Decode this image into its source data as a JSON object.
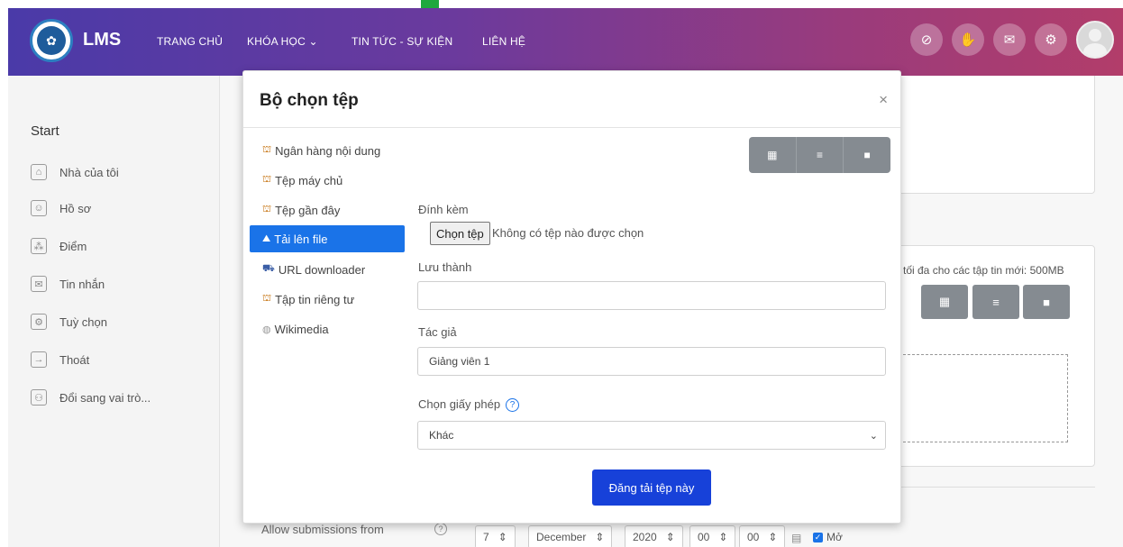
{
  "navbar": {
    "brand": "LMS",
    "links": [
      "TRANG CHỦ",
      "KHÓA HỌC ⌄",
      "TIN TỨC - SỰ KIỆN",
      "LIÊN HỆ"
    ],
    "icons": [
      "eye-slash-icon",
      "hand-icon",
      "chat-icon",
      "gear-icon"
    ]
  },
  "drawer": {
    "start": "Start",
    "items": [
      {
        "label": "Nhà của tôi",
        "icon": "home-icon"
      },
      {
        "label": "Hồ sơ",
        "icon": "profile-icon"
      },
      {
        "label": "Điểm",
        "icon": "grades-icon"
      },
      {
        "label": "Tin nhắn",
        "icon": "messages-icon"
      },
      {
        "label": "Tuỳ chọn",
        "icon": "preferences-icon"
      },
      {
        "label": "Thoát",
        "icon": "logout-icon"
      },
      {
        "label": "Đổi sang vai trò...",
        "icon": "switch-role-icon"
      }
    ]
  },
  "background": {
    "max_size": "tối đa cho các tập tin mới: 500MB",
    "allow_submissions": "Allow submissions from",
    "day": "7",
    "month": "December",
    "year": "2020",
    "hour": "00",
    "minute": "00",
    "enable_label": "Mở"
  },
  "modal": {
    "title": "Bộ chọn tệp",
    "close": "×",
    "repositories": [
      "Ngân hàng nội dung",
      "Tệp máy chủ",
      "Tệp gần đây",
      "Tải lên file",
      "URL downloader",
      "Tập tin riêng tư",
      "Wikimedia"
    ],
    "active_repository": "Tải lên file",
    "attachment_label": "Đính kèm",
    "choose_file_button": "Chọn tệp",
    "no_file_text": "Không có tệp nào được chọn",
    "save_as_label": "Lưu thành",
    "save_as_value": "",
    "author_label": "Tác giả",
    "author_value": "Giảng viên 1",
    "license_label": "Chọn giấy phép",
    "license_value": "Khác",
    "submit_button": "Đăng tải tệp này"
  },
  "colors": {
    "primary": "#1a73e8",
    "submit": "#1741d9",
    "view_buttons": "#858b91",
    "accent_green": "#1ea83d"
  }
}
